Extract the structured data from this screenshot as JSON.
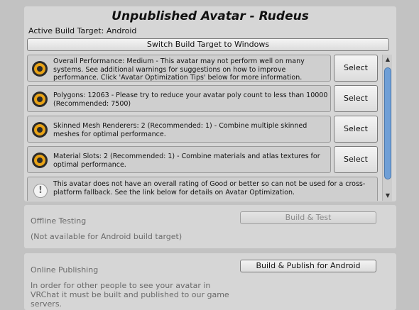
{
  "header": {
    "title": "Unpublished Avatar - Rudeus",
    "build_target": "Active Build Target: Android",
    "switch_button": "Switch Build Target to Windows"
  },
  "issues": [
    {
      "icon": "warning-icon",
      "message": "Overall Performance: Medium - This avatar may not perform well on many systems. See additional warnings for suggestions on how to improve performance. Click 'Avatar Optimization Tips' below for more information.",
      "button": "Select"
    },
    {
      "icon": "warning-icon",
      "message": "Polygons: 12063 - Please try to reduce your avatar poly count to less than 10000 (Recommended: 7500)",
      "button": "Select"
    },
    {
      "icon": "warning-icon",
      "message": "Skinned Mesh Renderers: 2 (Recommended: 1) - Combine multiple skinned meshes for optimal performance.",
      "button": "Select"
    },
    {
      "icon": "warning-icon",
      "message": "Material Slots: 2 (Recommended: 1) - Combine materials and atlas textures for optimal performance.",
      "button": "Select"
    }
  ],
  "info": {
    "icon": "info-icon",
    "glyph": "!",
    "message": "This avatar does not have an overall rating of Good or better so can not be used for a cross-platform fallback. See the link below for details on Avatar Optimization."
  },
  "scrollbar": {
    "up": "▲",
    "down": "▼"
  },
  "offline": {
    "title": "Offline Testing",
    "note": "(Not available for Android build target)",
    "button": "Build & Test"
  },
  "online": {
    "title": "Online Publishing",
    "description": "In order for other people to see your avatar in VRChat it must be built and published to our game servers.",
    "button": "Build & Publish for Android"
  },
  "colors": {
    "warning": "#e8a317",
    "scroll_thumb": "#6f9fd6",
    "panel": "#d6d6d6"
  }
}
